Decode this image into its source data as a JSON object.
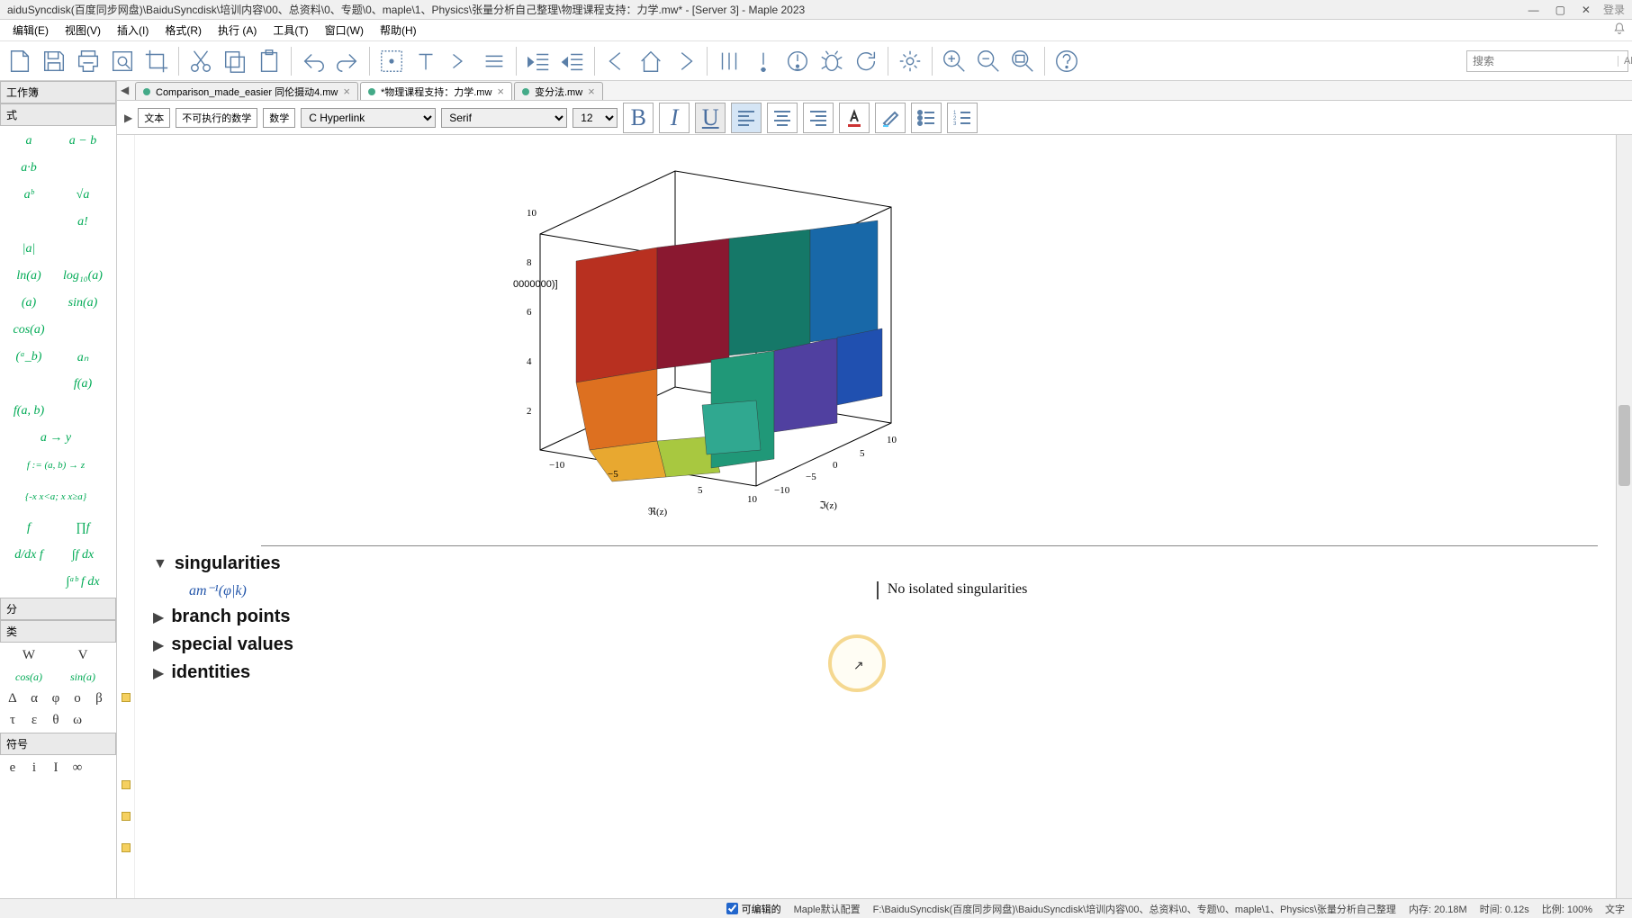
{
  "window": {
    "title": "aiduSyncdisk(百度同步网盘)\\BaiduSyncdisk\\培训内容\\00、总资料\\0、专题\\0、maple\\1、Physics\\张量分析自己整理\\物理课程支持：力学.mw* - [Server 3] - Maple 2023",
    "login": "登录"
  },
  "menu": {
    "items": [
      "编辑(E)",
      "视图(V)",
      "插入(I)",
      "格式(R)",
      "执行 (A)",
      "工具(T)",
      "窗口(W)",
      "帮助(H)"
    ]
  },
  "toolbar": {
    "search_placeholder": "搜索",
    "alt": "Alt-"
  },
  "palettes": {
    "hdr0": "工作簿",
    "hdr1": "式",
    "expr_cells": [
      "a",
      "a − b",
      "a·b",
      "",
      "aᵇ",
      "√a",
      "",
      "a!",
      "|a|",
      "",
      "ln(a)",
      "log₁₀(a)",
      "(a)",
      "sin(a)",
      "cos(a)",
      "",
      "(ᵃ_b)",
      "aₙ",
      "",
      "f(a)",
      "f(a, b)",
      "a → y",
      "f := (a, b) → z",
      "",
      "{-x  x<a; x  x≥a}",
      "",
      "f",
      "∏f",
      "d/dx f",
      "∫f dx",
      "",
      "∫ᵃᵇ f dx"
    ],
    "hdr2": "分",
    "hdr3": "类",
    "greek1": [
      "W",
      "V"
    ],
    "greek2": [
      "cos(a)",
      "sin(a)"
    ],
    "greek3": [
      "Δ",
      "α",
      "φ",
      "ο"
    ],
    "greek4": [
      "β",
      "τ",
      "ε",
      "θ"
    ],
    "greek5": [
      "ω"
    ],
    "hdr4": "符号",
    "sym_row": [
      "e",
      "i",
      "I",
      "∞"
    ]
  },
  "tabs": [
    {
      "label": "Comparison_made_easier 同伦摄动4.mw",
      "active": false
    },
    {
      "label": "*物理课程支持：力学.mw",
      "active": true
    },
    {
      "label": "变分法.mw",
      "active": false
    }
  ],
  "fmt": {
    "btn_text": "文本",
    "btn_noexec": "不可执行的数学",
    "btn_math": "数学",
    "style": "C Hyperlink",
    "font": "Serif",
    "size": "12"
  },
  "plot": {
    "z_axis_label": "0000000)]",
    "z_ticks": [
      "10",
      "8",
      "6",
      "4",
      "2"
    ],
    "x_ticks": [
      "−10",
      "−5",
      "5",
      "10"
    ],
    "y_ticks": [
      "−10",
      "−5",
      "0",
      "5",
      "10"
    ],
    "x_label": "ℜ(z)",
    "y_label": "ℑ(z)"
  },
  "sections": {
    "singularities": "singularities",
    "branch": "branch points",
    "special": "special values",
    "identities": "identities",
    "math_expr": "am⁻¹(φ|k)",
    "result": "No isolated singularities"
  },
  "status": {
    "editable": "可编辑的",
    "config": "Maple默认配置",
    "path": "F:\\BaiduSyncdisk(百度同步网盘)\\BaiduSyncdisk\\培训内容\\00、总资料\\0、专题\\0、maple\\1、Physics\\张量分析自己整理",
    "mem": "内存: 20.18M",
    "time": "时间: 0.12s",
    "scale": "比例: 100%",
    "mode": "文字"
  }
}
